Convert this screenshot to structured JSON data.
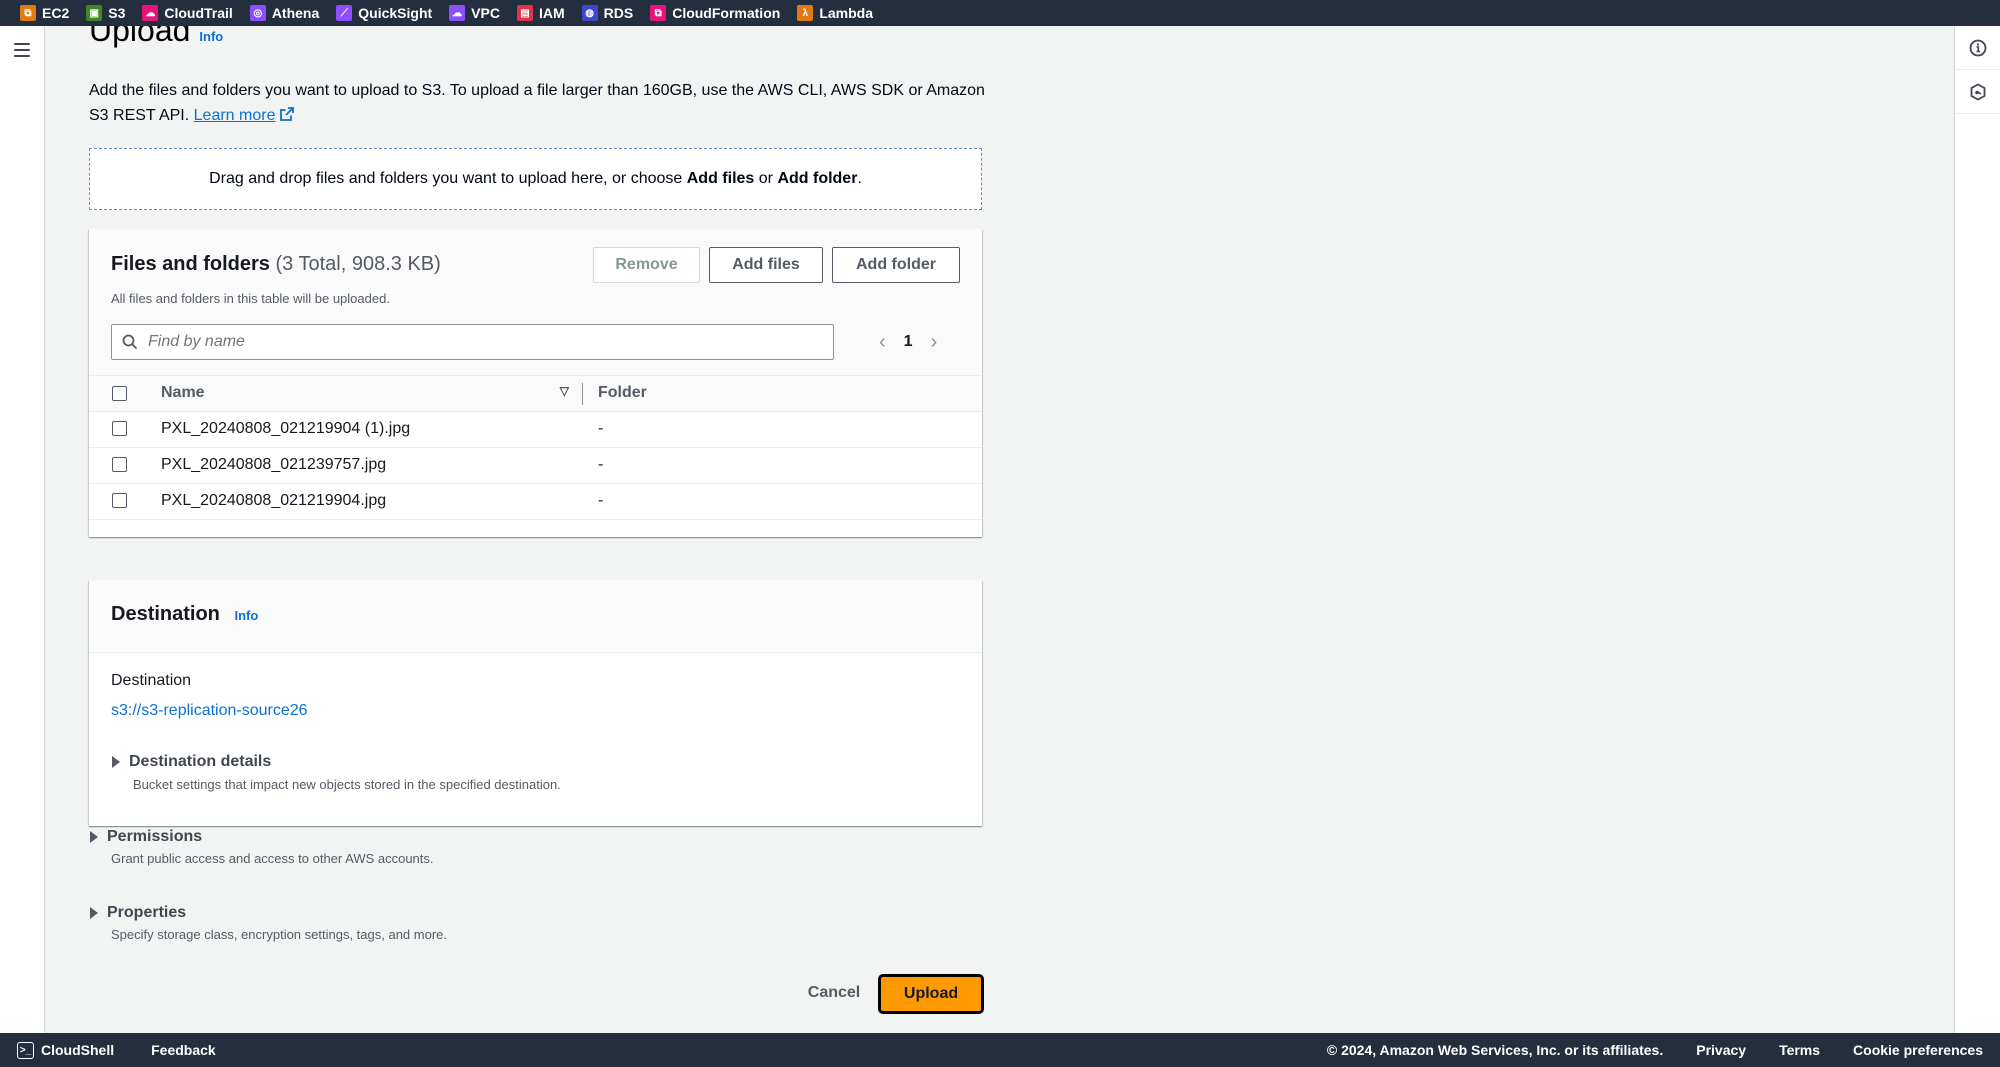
{
  "services_bar": [
    {
      "label": "EC2",
      "icon": "ec2-icon",
      "color": "#e07b13"
    },
    {
      "label": "S3",
      "icon": "s3-icon",
      "color": "#3f8624"
    },
    {
      "label": "CloudTrail",
      "icon": "cloudtrail-icon",
      "color": "#e7157b"
    },
    {
      "label": "Athena",
      "icon": "athena-icon",
      "color": "#8c4fff"
    },
    {
      "label": "QuickSight",
      "icon": "quicksight-icon",
      "color": "#8c4fff"
    },
    {
      "label": "VPC",
      "icon": "vpc-icon",
      "color": "#8c4fff"
    },
    {
      "label": "IAM",
      "icon": "iam-icon",
      "color": "#dd344c"
    },
    {
      "label": "RDS",
      "icon": "rds-icon",
      "color": "#3b48cc"
    },
    {
      "label": "CloudFormation",
      "icon": "cloudformation-icon",
      "color": "#e7157b"
    },
    {
      "label": "Lambda",
      "icon": "lambda-icon",
      "color": "#e07b13"
    }
  ],
  "page": {
    "title": "Upload",
    "info_label": "Info",
    "description": "Add the files and folders you want to upload to S3. To upload a file larger than 160GB, use the AWS CLI, AWS SDK or Amazon S3 REST API.",
    "learn_more": "Learn more"
  },
  "dropzone": {
    "text_before": "Drag and drop files and folders you want to upload here, or choose ",
    "add_files": "Add files",
    "or": " or ",
    "add_folder": "Add folder",
    "period": "."
  },
  "files_panel": {
    "title": "Files and folders",
    "count": "(3 Total, 908.3 KB)",
    "subtitle": "All files and folders in this table will be uploaded.",
    "remove_label": "Remove",
    "add_files_label": "Add files",
    "add_folder_label": "Add folder",
    "search_placeholder": "Find by name",
    "current_page": "1",
    "columns": [
      "Name",
      "Folder"
    ],
    "rows": [
      {
        "name": "PXL_20240808_021219904 (1).jpg",
        "folder": "-"
      },
      {
        "name": "PXL_20240808_021239757.jpg",
        "folder": "-"
      },
      {
        "name": "PXL_20240808_021219904.jpg",
        "folder": "-"
      }
    ]
  },
  "destination_panel": {
    "title": "Destination",
    "info_label": "Info",
    "label": "Destination",
    "value": "s3://s3-replication-source26",
    "details_title": "Destination details",
    "details_desc": "Bucket settings that impact new objects stored in the specified destination."
  },
  "permissions": {
    "title": "Permissions",
    "desc": "Grant public access and access to other AWS accounts."
  },
  "properties": {
    "title": "Properties",
    "desc": "Specify storage class, encryption settings, tags, and more."
  },
  "actions": {
    "cancel": "Cancel",
    "upload": "Upload"
  },
  "footer": {
    "cloudshell": "CloudShell",
    "feedback": "Feedback",
    "copyright": "© 2024, Amazon Web Services, Inc. or its affiliates.",
    "privacy": "Privacy",
    "terms": "Terms",
    "cookie": "Cookie preferences"
  }
}
